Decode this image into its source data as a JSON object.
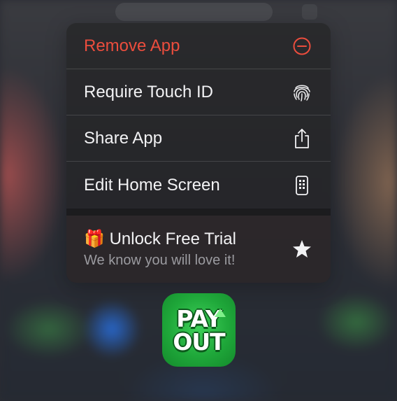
{
  "menu": {
    "items": [
      {
        "label": "Remove App",
        "icon": "minus-circle-icon",
        "style": "destructive"
      },
      {
        "label": "Require Touch ID",
        "icon": "fingerprint-icon"
      },
      {
        "label": "Share App",
        "icon": "share-icon"
      },
      {
        "label": "Edit Home Screen",
        "icon": "phone-icon"
      }
    ],
    "promo": {
      "emoji": "🎁",
      "title": "Unlock Free Trial",
      "subtitle": "We know you will love it!",
      "icon": "star-icon"
    }
  },
  "app": {
    "icon_line1": "PAY",
    "icon_line2": "OUT"
  },
  "colors": {
    "destructive": "#eb4d3d",
    "text": "#f2f2f4",
    "secondary_text": "#9b9ba0",
    "app_green": "#1fa83a"
  }
}
